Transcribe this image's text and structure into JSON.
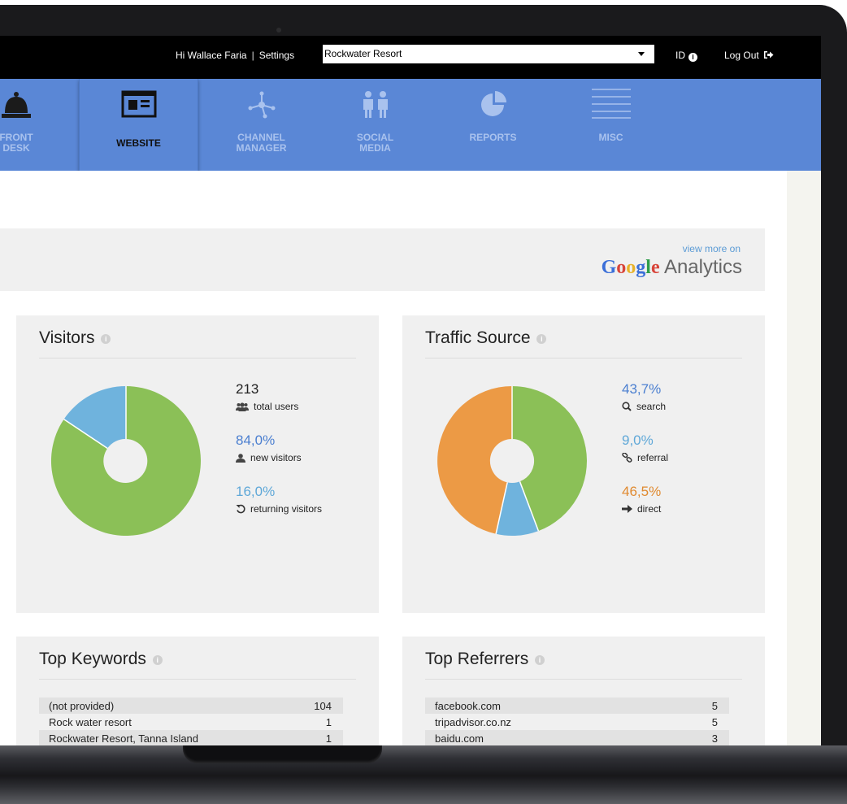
{
  "topbar": {
    "greeting": "Hi Wallace Faria",
    "separator": "|",
    "settings": "Settings",
    "property_selected": "Rockwater Resort",
    "id_label": "ID",
    "logout_label": "Log Out"
  },
  "nav": {
    "items": [
      {
        "label_line1": "FRONT",
        "label_line2": "DESK",
        "icon": "bell-icon"
      },
      {
        "label_line1": "WEBSITE",
        "label_line2": "",
        "icon": "website-icon"
      },
      {
        "label_line1": "CHANNEL",
        "label_line2": "MANAGER",
        "icon": "network-icon"
      },
      {
        "label_line1": "SOCIAL",
        "label_line2": "MEDIA",
        "icon": "people-icon"
      },
      {
        "label_line1": "REPORTS",
        "label_line2": "",
        "icon": "pie-icon"
      },
      {
        "label_line1": "MISC",
        "label_line2": "",
        "icon": "lines-icon"
      }
    ]
  },
  "analytics": {
    "view_more": "view more on",
    "brand": "Google",
    "product": "Analytics"
  },
  "visitors": {
    "title": "Visitors",
    "total_value": "213",
    "total_label": "total users",
    "new_value": "84,0%",
    "new_label": "new visitors",
    "returning_value": "16,0%",
    "returning_label": "returning visitors",
    "colors": {
      "new": "#8bc057",
      "returning": "#6fb3dd"
    }
  },
  "traffic": {
    "title": "Traffic Source",
    "search_value": "43,7%",
    "search_label": "search",
    "referral_value": "9,0%",
    "referral_label": "referral",
    "direct_value": "46,5%",
    "direct_label": "direct",
    "colors": {
      "search": "#8bc057",
      "referral": "#6fb3dd",
      "direct": "#ec9a45"
    }
  },
  "keywords": {
    "title": "Top Keywords",
    "rows": [
      {
        "term": "(not provided)",
        "count": "104"
      },
      {
        "term": "Rock water resort",
        "count": "1"
      },
      {
        "term": "Rockwater Resort, Tanna Island",
        "count": "1"
      }
    ]
  },
  "referrers": {
    "title": "Top Referrers",
    "rows": [
      {
        "site": "facebook.com",
        "count": "5"
      },
      {
        "site": "tripadvisor.co.nz",
        "count": "5"
      },
      {
        "site": "baidu.com",
        "count": "3"
      }
    ]
  }
}
